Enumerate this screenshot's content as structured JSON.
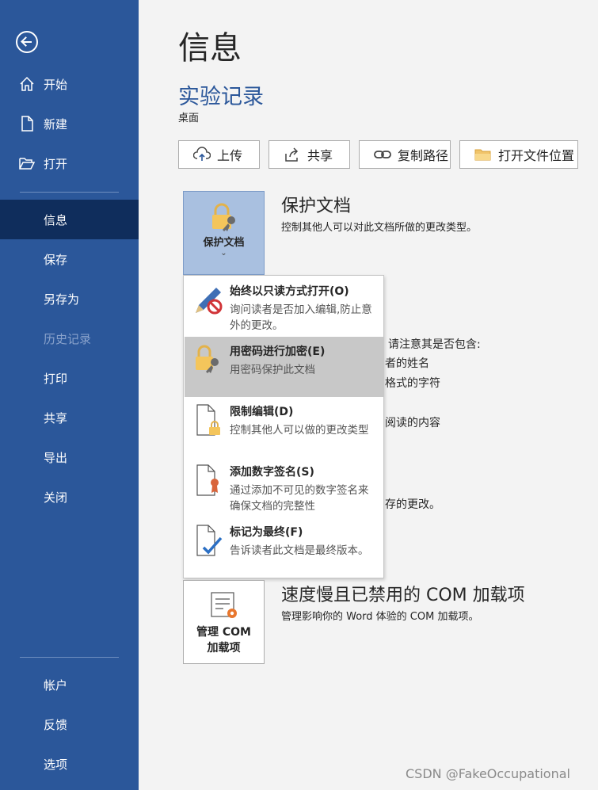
{
  "sidebar": {
    "back_icon": "back-arrow-icon",
    "items_top": [
      {
        "label": "开始",
        "icon": "home-icon"
      },
      {
        "label": "新建",
        "icon": "new-document-icon"
      },
      {
        "label": "打开",
        "icon": "open-folder-icon"
      }
    ],
    "items_middle": [
      {
        "label": "信息",
        "active": true
      },
      {
        "label": "保存"
      },
      {
        "label": "另存为"
      },
      {
        "label": "历史记录",
        "disabled": true
      },
      {
        "label": "打印"
      },
      {
        "label": "共享"
      },
      {
        "label": "导出"
      },
      {
        "label": "关闭"
      }
    ],
    "items_bottom": [
      {
        "label": "帐户"
      },
      {
        "label": "反馈"
      },
      {
        "label": "选项"
      }
    ]
  },
  "main": {
    "page_title": "信息",
    "doc_title": "实验记录",
    "doc_location": "桌面",
    "actions": [
      {
        "label": "上传",
        "icon": "cloud-upload-icon"
      },
      {
        "label": "共享",
        "icon": "share-icon"
      },
      {
        "label": "复制路径",
        "icon": "link-icon"
      },
      {
        "label": "打开文件位置",
        "icon": "folder-icon"
      }
    ],
    "protect": {
      "tile_label": "保护文档",
      "tile_chevron": "⌄",
      "title": "保护文档",
      "desc": "控制其他人可以对此文档所做的更改类型。"
    },
    "hidden_partial": {
      "line1": "请注意其是否包含:",
      "line2": "者的姓名",
      "line3": "格式的字符",
      "line4": "阅读的内容",
      "line5": "存的更改。"
    },
    "protect_menu": [
      {
        "title": "始终以只读方式打开(O)",
        "desc": "询问读者是否加入编辑,防止意外的更改。",
        "icon": "pencil-prohibited-icon"
      },
      {
        "title": "用密码进行加密(E)",
        "desc": "用密码保护此文档",
        "icon": "lock-key-icon",
        "highlighted": true
      },
      {
        "title": "限制编辑(D)",
        "desc": "控制其他人可以做的更改类型",
        "icon": "document-lock-icon"
      },
      {
        "title": "添加数字签名(S)",
        "desc": "通过添加不可见的数字签名来确保文档的完整性",
        "icon": "document-ribbon-icon"
      },
      {
        "title": "标记为最终(F)",
        "desc": "告诉读者此文档是最终版本。",
        "icon": "document-check-icon"
      }
    ],
    "com": {
      "tile_label_line1": "管理 COM",
      "tile_label_line2": "加载项",
      "title": "速度慢且已禁用的 COM 加载项",
      "desc": "管理影响你的 Word 体验的 COM 加载项。"
    }
  },
  "watermark": "CSDN @FakeOccupational",
  "colors": {
    "sidebar": "#2b579a",
    "sidebar_active": "#0f2d5c",
    "accent_title": "#2b579a",
    "menu_highlight": "#c8c8c8",
    "tile_selected": "#a9c0e0"
  }
}
